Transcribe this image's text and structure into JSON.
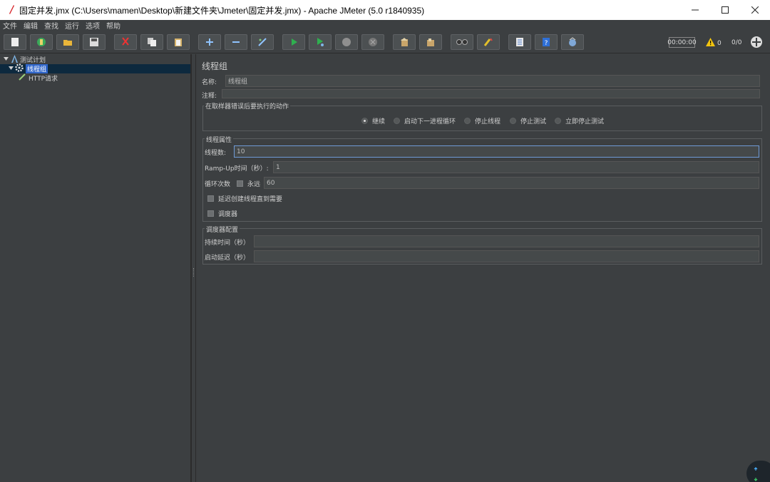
{
  "window": {
    "title": "固定并发.jmx (C:\\Users\\mamen\\Desktop\\新建文件夹\\Jmeter\\固定并发.jmx) - Apache JMeter (5.0 r1840935)"
  },
  "menu": [
    "文件",
    "编辑",
    "查找",
    "运行",
    "选项",
    "帮助"
  ],
  "toolbar": {
    "buttons": [
      "new-icon",
      "templates-icon",
      "open-icon",
      "save-icon",
      "cut-icon",
      "copy-icon",
      "paste-icon",
      "expand-icon",
      "collapse-icon",
      "toggle-icon",
      "start-icon",
      "start-no-pause-icon",
      "stop-icon",
      "shutdown-icon",
      "clear-icon",
      "clear-all-icon",
      "search-icon",
      "reset-search-icon",
      "function-helper-icon",
      "help-icon",
      "remote-icon"
    ],
    "timer": "00:00:00",
    "warnings": "0",
    "threads": "0/0"
  },
  "tree": {
    "plan": "测试计划",
    "thread_group": "线程组",
    "http_request": "HTTP请求"
  },
  "panel": {
    "title": "线程组",
    "name_label": "名称:",
    "name_value": "线程组",
    "comment_label": "注释:",
    "comment_value": "",
    "error_group_title": "在取样器错误后要执行的动作",
    "error_actions": [
      "继续",
      "启动下一进程循环",
      "停止线程",
      "停止测试",
      "立即停止测试"
    ],
    "error_selected": 0,
    "thread_props_title": "线程属性",
    "threads_label": "线程数:",
    "threads_value": "10",
    "rampup_label": "Ramp-Up时间（秒）:",
    "rampup_value": "1",
    "loop_label": "循环次数",
    "forever_label": "永远",
    "loop_value": "60",
    "delay_create_label": "延迟创建线程直到需要",
    "scheduler_label": "调度器",
    "scheduler_config_title": "调度器配置",
    "duration_label": "持续时间（秒）",
    "duration_value": "",
    "startup_delay_label": "启动延迟（秒）",
    "startup_delay_value": ""
  }
}
